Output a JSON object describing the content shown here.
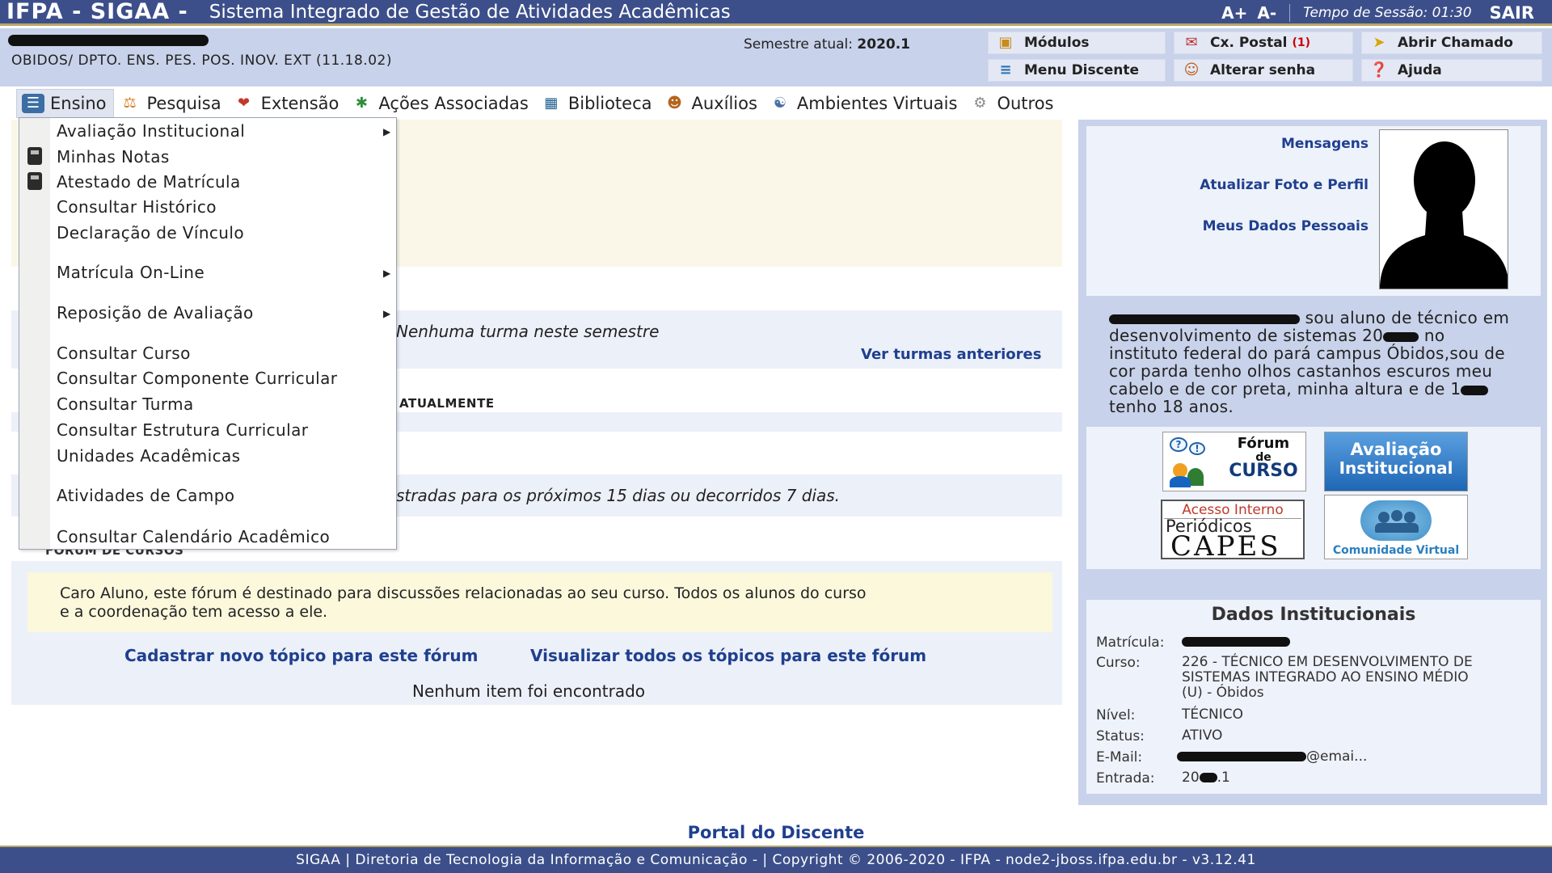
{
  "topbar": {
    "brand": "IFPA - SIGAA -",
    "system_name": "Sistema Integrado de Gestão de Atividades Acadêmicas",
    "font_increase": "A+",
    "font_decrease": "A-",
    "session_label": "Tempo de Sessão: 01:30",
    "logout": "SAIR"
  },
  "info": {
    "unit": "OBIDOS/ DPTO. ENS. PES. POS. INOV. EXT (11.18.02)",
    "semester_label": "Semestre atual:",
    "semester_value": "2020.1"
  },
  "quick_links": {
    "modulos": "Módulos",
    "caixa_postal": "Cx. Postal",
    "caixa_postal_count": "(1)",
    "abrir_chamado": "Abrir Chamado",
    "menu_discente": "Menu Discente",
    "alterar_senha": "Alterar senha",
    "ajuda": "Ajuda"
  },
  "main_menu": {
    "ensino": "Ensino",
    "pesquisa": "Pesquisa",
    "extensao": "Extensão",
    "acoes": "Ações Associadas",
    "biblioteca": "Biblioteca",
    "auxilios": "Auxílios",
    "ambientes": "Ambientes Virtuais",
    "outros": "Outros"
  },
  "dropdown": {
    "avaliacao": "Avaliação Institucional",
    "minhas_notas": "Minhas Notas",
    "atestado": "Atestado de Matrícula",
    "historico": "Consultar Histórico",
    "declaracao": "Declaração de Vínculo",
    "matricula": "Matrícula On-Line",
    "reposicao": "Reposição de Avaliação",
    "curso": "Consultar Curso",
    "componente": "Consultar Componente Curricular",
    "turma": "Consultar Turma",
    "estrutura": "Consultar Estrutura Curricular",
    "unidades": "Unidades Acadêmicas",
    "atividades_campo": "Atividades de Campo",
    "calendario": "Consultar Calendário Acadêmico"
  },
  "main": {
    "no_turma": "Nenhuma turma neste semestre",
    "ver_turmas": "Ver turmas anteriores",
    "atualmente": "ATUALMENTE",
    "atividades": "stradas para os próximos 15 dias ou decorridos 7 dias.",
    "forum_header": "FÓRUM DE CURSOS",
    "forum_notice_1": "Caro Aluno, este fórum é destinado para discussões relacionadas ao seu curso. Todos os alunos do curso",
    "forum_notice_2": "e a coordenação tem acesso a ele.",
    "forum_new": "Cadastrar novo tópico para este fórum",
    "forum_all": "Visualizar todos os tópicos para este fórum",
    "forum_empty": "Nenhum item foi encontrado"
  },
  "profile": {
    "mensagens": "Mensagens",
    "atualizar_foto": "Atualizar Foto e Perfil",
    "dados_pessoais": "Meus Dados Pessoais",
    "bio_1": " sou aluno de técnico em",
    "bio_2": "desenvolvimento de sistemas 20",
    "bio_2b": " no",
    "bio_3": "instituto federal do pará campus Óbidos,sou de",
    "bio_4": "cor parda tenho olhos castanhos escuros meu",
    "bio_5": "cabelo e de cor preta, minha altura e de 1",
    "bio_6": "tenho 18 anos."
  },
  "banners": {
    "forum_curso_1": "Fórum",
    "forum_curso_2": "de",
    "forum_curso_3": "CURSO",
    "avaliacao_1": "Avaliação",
    "avaliacao_2": "Institucional",
    "capes_1": "Acesso Interno",
    "capes_2": "Periódicos",
    "capes_3": "CAPES",
    "comunidade": "Comunidade Virtual"
  },
  "dados": {
    "title": "Dados Institucionais",
    "matricula_label": "Matrícula:",
    "curso_label": "Curso:",
    "curso_value_1": "226 - TÉCNICO EM DESENVOLVIMENTO DE",
    "curso_value_2": "SISTEMAS INTEGRADO AO ENSINO MÉDIO",
    "curso_value_3": "(U) - Óbidos",
    "nivel_label": "Nível:",
    "nivel_value": "TÉCNICO",
    "status_label": "Status:",
    "status_value": "ATIVO",
    "email_label": "E-Mail:",
    "email_value": "@emai...",
    "entrada_label": "Entrada:",
    "entrada_value_a": "20",
    "entrada_value_b": ".1"
  },
  "footer": {
    "portal": "Portal do Discente",
    "text": "SIGAA | Diretoria de Tecnologia da Informação e Comunicação - | Copyright © 2006-2020 - IFPA - node2-jboss.ifpa.edu.br - v3.12.41"
  },
  "colors": {
    "header_bg": "#3c4f8a",
    "link": "#1f3f8f",
    "panel_bg": "#c8d2ea"
  }
}
